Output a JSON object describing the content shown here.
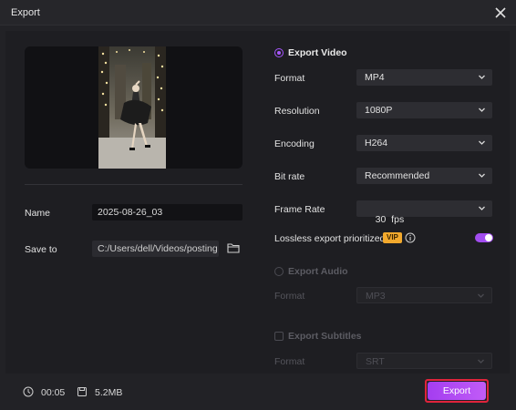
{
  "window": {
    "title": "Export"
  },
  "left": {
    "name_label": "Name",
    "name_value": "2025-08-26_03",
    "save_to_label": "Save to",
    "save_to_value": "C:/Users/dell/Videos/posting"
  },
  "export_video": {
    "label": "Export Video",
    "selected": true,
    "settings": [
      {
        "label": "Format",
        "value": "MP4"
      },
      {
        "label": "Resolution",
        "value": "1080P"
      },
      {
        "label": "Encoding",
        "value": "H264"
      },
      {
        "label": "Bit rate",
        "value": "Recommended"
      },
      {
        "label": "Frame Rate",
        "value": "30  fps"
      }
    ],
    "lossless_label": "Lossless export prioritized",
    "vip_badge": "VIP",
    "lossless_enabled": true
  },
  "export_audio": {
    "label": "Export Audio",
    "selected": false,
    "format_label": "Format",
    "format_value": "MP3"
  },
  "export_subtitles": {
    "label": "Export Subtitles",
    "checked": false,
    "format_label": "Format",
    "format_value": "SRT"
  },
  "footer": {
    "duration": "00:05",
    "size": "5.2MB",
    "export_label": "Export"
  },
  "colors": {
    "accent": "#a857ff",
    "export_button": "#b14ef4",
    "export_outline": "#e0243b",
    "vip_badge": "#f2a92d"
  }
}
